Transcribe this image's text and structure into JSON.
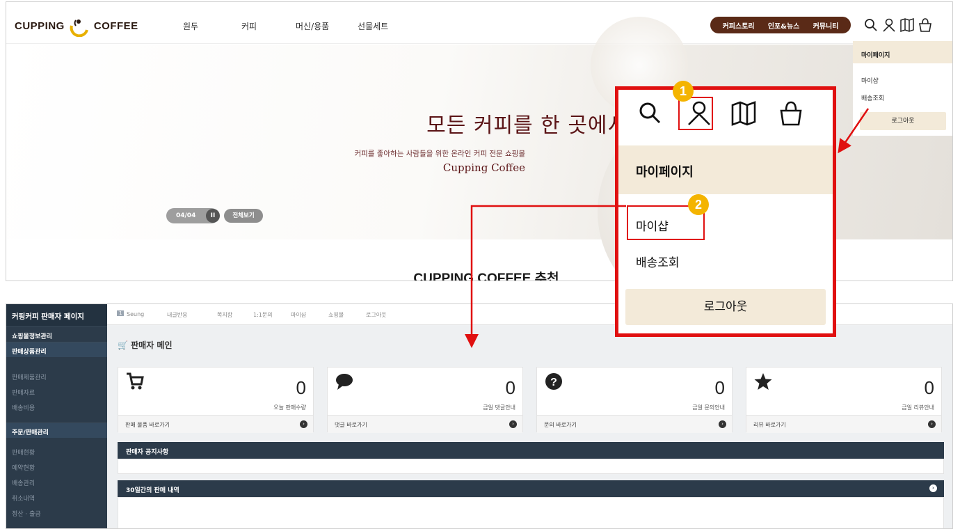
{
  "shop": {
    "logo_left": "CUPPING",
    "logo_right": "COFFEE",
    "nav": [
      "원두",
      "커피",
      "머신/용품",
      "선물세트"
    ],
    "pill": [
      "커피스토리",
      "인포&뉴스",
      "커뮤니티"
    ],
    "hero": {
      "title": "모든 커피를 한 곳에서 만나다.",
      "subtitle": "커피를 좋아하는 사람들을 위한 온라인 커피 전문 쇼핑몰",
      "brand": "Cupping Coffee",
      "slide_counter": "04/04",
      "pause": "II",
      "view_all": "전체보기"
    },
    "section_title": "CUPPING COFFEE 추천",
    "dropdown": {
      "header": "마이페이지",
      "items": [
        "마이샵",
        "배송조회"
      ],
      "logout": "로그아웃"
    }
  },
  "zoom": {
    "header": "마이페이지",
    "items": [
      "마이샵",
      "배송조회"
    ],
    "logout": "로그아웃",
    "badges": [
      "1",
      "2"
    ]
  },
  "admin": {
    "brand": "커핑커피 판매자 페이지",
    "sidebar": {
      "sections": [
        {
          "title": "쇼핑몰정보관리",
          "items": []
        },
        {
          "title": "판매상품관리",
          "items": [
            "판매제품관리",
            "판매자료",
            "배송비용"
          ]
        },
        {
          "title": "주문/판매관리",
          "items": [
            "판매현황",
            "예약현황",
            "배송관리",
            "취소내역",
            "정산 · 출금"
          ]
        }
      ]
    },
    "topbar": {
      "user_badge": "1",
      "user": "Seung",
      "links": [
        "내글반응",
        "쪽지함",
        "1:1문의",
        "마이샵",
        "쇼핑몰",
        "로그아웃"
      ]
    },
    "page_title": "판매자 메인",
    "cards": [
      {
        "value": "0",
        "label": "오늘 판매수량",
        "link": "판매 물품 바로가기",
        "icon": "cart-icon"
      },
      {
        "value": "0",
        "label": "금일 댓글안내",
        "link": "댓글 바로가기",
        "icon": "comment-icon"
      },
      {
        "value": "0",
        "label": "금일 문의안내",
        "link": "문의 바로가기",
        "icon": "question-icon"
      },
      {
        "value": "0",
        "label": "금일 리뷰안내",
        "link": "리뷰 바로가기",
        "icon": "star-icon"
      }
    ],
    "panels": [
      "판매자 공지사항",
      "30일간의 판매 내역"
    ]
  },
  "colors": {
    "accent_red": "#e01010",
    "brown": "#5a2a17",
    "beige": "#f3ead9",
    "navy": "#2c3b4a",
    "badge": "#f4b400"
  }
}
